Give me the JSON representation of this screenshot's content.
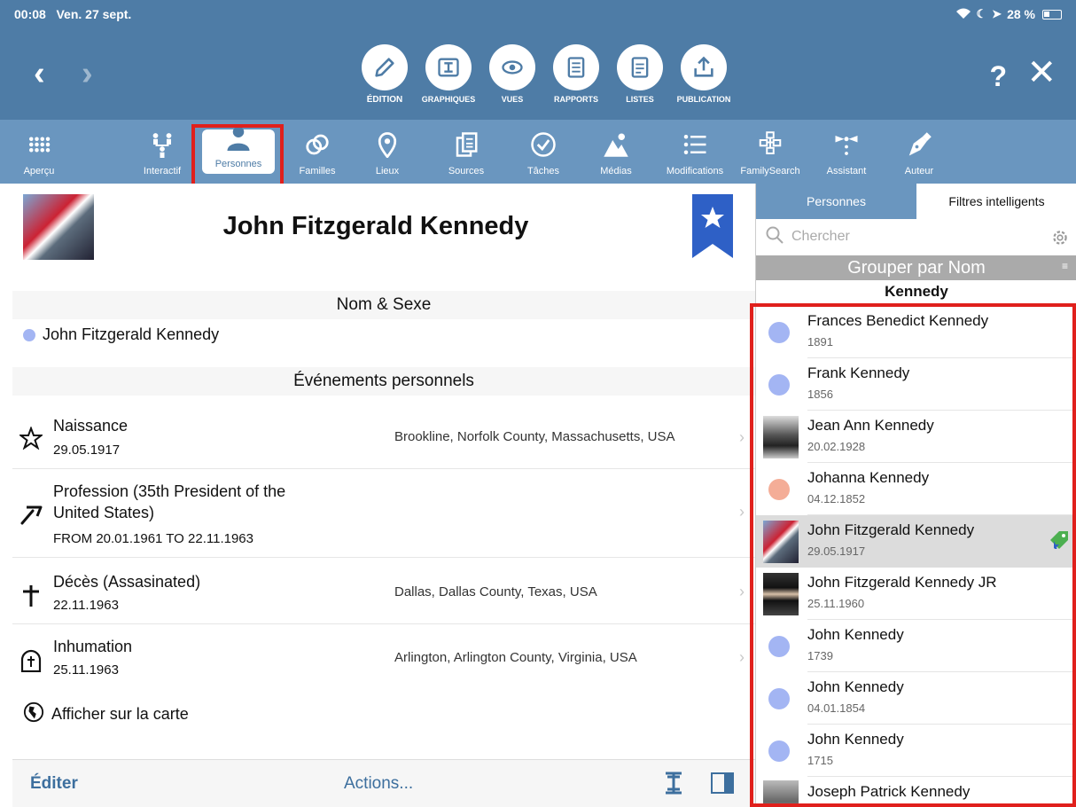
{
  "status": {
    "time": "00:08",
    "date": "Ven. 27 sept.",
    "battery": "28 %"
  },
  "modes": [
    {
      "label": "ÉDITION",
      "icon": "pencil-icon"
    },
    {
      "label": "GRAPHIQUES",
      "icon": "chart-icon"
    },
    {
      "label": "VUES",
      "icon": "eye-icon"
    },
    {
      "label": "RAPPORTS",
      "icon": "document-icon"
    },
    {
      "label": "LISTES",
      "icon": "list-icon"
    },
    {
      "label": "PUBLICATION",
      "icon": "upload-icon"
    }
  ],
  "help_label": "?",
  "tools": [
    {
      "label": "Aperçu",
      "icon": "grid-icon"
    },
    {
      "label": "Interactif",
      "icon": "tree-icon"
    },
    {
      "label": "Personnes",
      "icon": "person-icon"
    },
    {
      "label": "Familles",
      "icon": "rings-icon"
    },
    {
      "label": "Lieux",
      "icon": "map-pin-icon"
    },
    {
      "label": "Sources",
      "icon": "copy-icon"
    },
    {
      "label": "Tâches",
      "icon": "check-circle-icon"
    },
    {
      "label": "Médias",
      "icon": "image-icon"
    },
    {
      "label": "Modifications",
      "icon": "list-lines-icon"
    },
    {
      "label": "FamilySearch",
      "icon": "familysearch-icon"
    },
    {
      "label": "Assistant",
      "icon": "assistant-icon"
    },
    {
      "label": "Auteur",
      "icon": "pen-nib-icon"
    }
  ],
  "person": {
    "name": "John Fitzgerald Kennedy"
  },
  "sections": {
    "name_sex": "Nom & Sexe",
    "events": "Événements personnels"
  },
  "name_entry": "John Fitzgerald Kennedy",
  "events": [
    {
      "title": "Naissance",
      "date": "29.05.1917",
      "place": "Brookline, Norfolk County, Massachusetts, USA",
      "icon": "star-icon"
    },
    {
      "title_line1": "Profession (35th President of the",
      "title_line2": "United States)",
      "date": "FROM 20.01.1961 TO 22.11.1963",
      "place": "",
      "icon": "pickaxe-icon"
    },
    {
      "title": "Décès (Assasinated)",
      "date": "22.11.1963",
      "place": "Dallas, Dallas County, Texas, USA",
      "icon": "cross-icon"
    },
    {
      "title": "Inhumation",
      "date": "25.11.1963",
      "place": "Arlington, Arlington County, Virginia, USA",
      "icon": "tombstone-icon"
    }
  ],
  "map_link": "Afficher sur la carte",
  "bottom": {
    "edit": "Éditer",
    "actions": "Actions..."
  },
  "sidebar": {
    "tab_persons": "Personnes",
    "tab_filters": "Filtres intelligents",
    "search_placeholder": "Chercher",
    "group_by": "Grouper par Nom",
    "group_header": "Kennedy",
    "list": [
      {
        "name": "Frances Benedict Kennedy",
        "year": "1891",
        "avatar": "dot",
        "color": "#a3b5f3"
      },
      {
        "name": "Frank Kennedy",
        "year": "1856",
        "avatar": "dot",
        "color": "#a3b5f3"
      },
      {
        "name": "Jean Ann Kennedy",
        "year": "20.02.1928",
        "avatar": "photo"
      },
      {
        "name": "Johanna Kennedy",
        "year": "04.12.1852",
        "avatar": "dot",
        "color": "#f4ad97"
      },
      {
        "name": "John Fitzgerald Kennedy",
        "year": "29.05.1917",
        "avatar": "photo",
        "selected": true
      },
      {
        "name": "John Fitzgerald Kennedy JR",
        "year": "25.11.1960",
        "avatar": "photo"
      },
      {
        "name": "John Kennedy",
        "year": "1739",
        "avatar": "dot",
        "color": "#a3b5f3"
      },
      {
        "name": "John Kennedy",
        "year": "04.01.1854",
        "avatar": "dot",
        "color": "#a3b5f3"
      },
      {
        "name": "John Kennedy",
        "year": "1715",
        "avatar": "dot",
        "color": "#a3b5f3"
      },
      {
        "name": "Joseph Patrick Kennedy",
        "year": "",
        "avatar": "photo"
      }
    ]
  },
  "colors": {
    "header": "#4e7ca6",
    "toolbar": "#6a96bf",
    "highlight": "#e0201c",
    "link": "#3d6f9e",
    "male_dot": "#a3b5f3",
    "female_dot": "#f4ad97"
  }
}
